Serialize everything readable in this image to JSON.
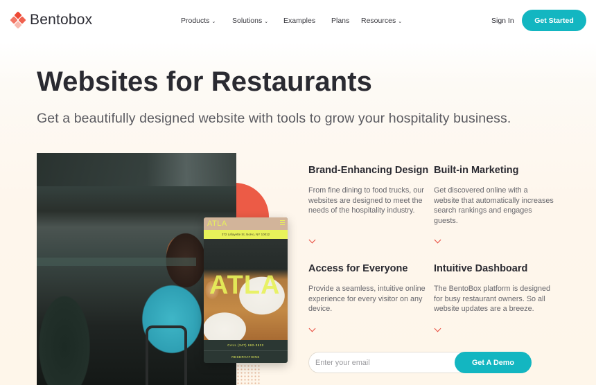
{
  "brand": {
    "name": "Bentobox",
    "colors": {
      "accent": "#13b6c1",
      "logo_red": "#ee4a36",
      "chevron": "#e8473a",
      "circle": "#ec5b46"
    }
  },
  "nav": {
    "items": [
      {
        "label": "Products",
        "has_dropdown": true,
        "icon": "chevron-down-icon"
      },
      {
        "label": "Solutions",
        "has_dropdown": true,
        "icon": "chevron-down-icon"
      },
      {
        "label": "Examples",
        "has_dropdown": false
      },
      {
        "label": "Plans",
        "has_dropdown": false
      },
      {
        "label": "Resources",
        "has_dropdown": true,
        "icon": "chevron-down-icon"
      }
    ],
    "chevron_glyph": "⌄",
    "sign_in": "Sign In",
    "get_started": "Get Started"
  },
  "hero": {
    "title": "Websites for Restaurants",
    "subtitle": "Get a beautifully designed website with tools to grow your hospitality business."
  },
  "mockup": {
    "brand": "ATLA",
    "address": "372 Lafayette St, NoHo, NY 10012",
    "big_text": "ATLA",
    "call": "CALL (347) 662-3522",
    "reservations": "RESERVATIONS"
  },
  "features": [
    {
      "title": "Brand-Enhancing Design",
      "body": "From fine dining to food trucks, our websites are designed to meet the needs of the hospitality industry."
    },
    {
      "title": "Built-in Marketing",
      "body": "Get discovered online with a website that automatically increases search rankings and engages guests."
    },
    {
      "title": "Access for Everyone",
      "body": "Provide a seamless, intuitive online experience for every visitor on any device."
    },
    {
      "title": "Intuitive Dashboard",
      "body": "The BentoBox platform is designed for busy restaurant owners. So all website updates are a breeze."
    }
  ],
  "demo_form": {
    "email_value": "",
    "email_placeholder": "Enter your email",
    "button": "Get A Demo"
  }
}
